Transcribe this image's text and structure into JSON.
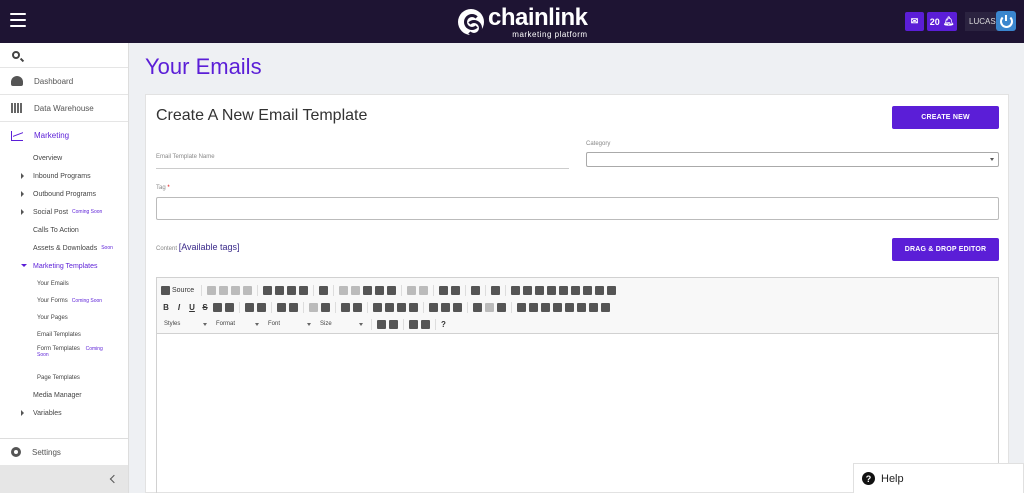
{
  "header": {
    "logo_name": "chainlink",
    "logo_sub": "marketing platform",
    "notif_count": "20",
    "user": "LUCAS"
  },
  "sidebar": {
    "dashboard": "Dashboard",
    "data_warehouse": "Data Warehouse",
    "marketing": "Marketing",
    "overview": "Overview",
    "inbound": "Inbound Programs",
    "outbound": "Outbound Programs",
    "social": "Social Post",
    "social_badge": "Coming Soon",
    "cta": "Calls To Action",
    "assets": "Assets & Downloads",
    "assets_badge": "Soon",
    "mkt_templates": "Marketing Templates",
    "your_emails": "Your Emails",
    "your_forms": "Your Forms",
    "your_forms_badge": "Coming Soon",
    "your_pages": "Your Pages",
    "email_templates": "Email Templates",
    "form_templates": "Form Templates",
    "form_templates_badge_1": "Coming",
    "form_templates_badge_2": "Soon",
    "page_templates": "Page Templates",
    "media_manager": "Media Manager",
    "variables": "Variables",
    "settings": "Settings"
  },
  "main": {
    "page_title": "Your Emails",
    "card_title": "Create A New Email Template",
    "create_new": "CREATE NEW",
    "email_template_name_label": "Email Template Name",
    "category_label": "Category",
    "tag_label": "Tag",
    "tag_required": "*",
    "content_label": "Content",
    "available_tags": "[Available tags]",
    "dnd_editor": "DRAG & DROP EDITOR"
  },
  "editor": {
    "source": "Source",
    "bold": "B",
    "italic": "I",
    "underline": "U",
    "strike": "S",
    "styles": "Styles",
    "format": "Format",
    "font": "Font",
    "size": "Size",
    "help": "?"
  },
  "help_widget": {
    "label": "Help"
  }
}
